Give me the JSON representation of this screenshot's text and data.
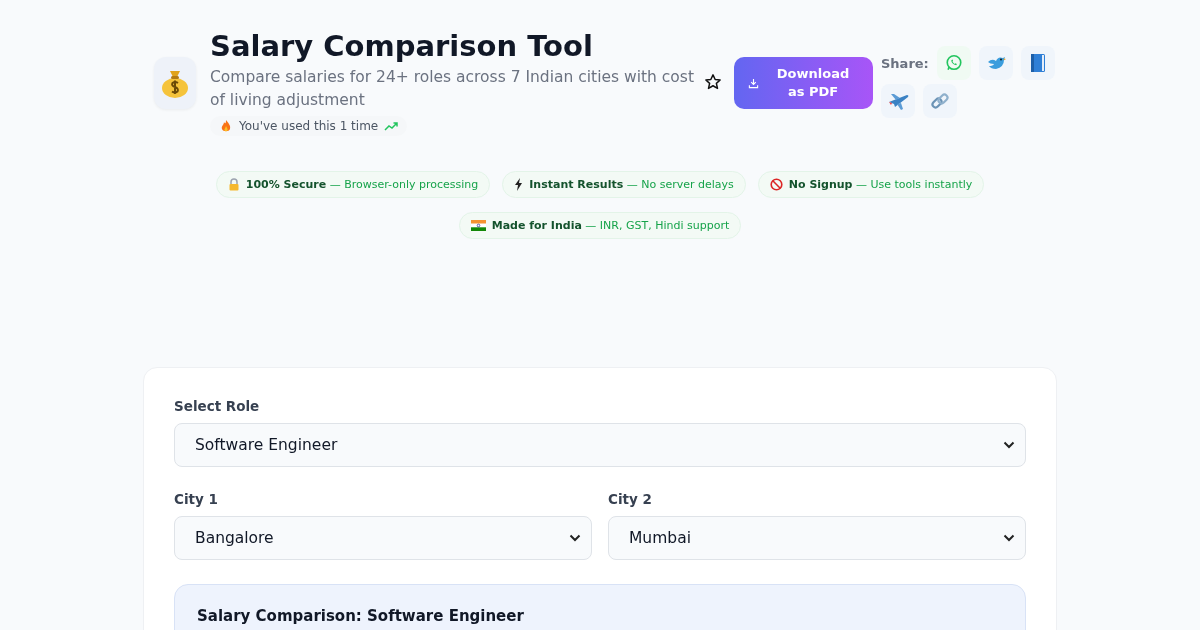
{
  "header": {
    "title": "Salary Comparison Tool",
    "subtitle": "Compare salaries for 24+ roles across 7 Indian cities with cost of living adjustment",
    "usage": "You've used this 1 time",
    "favorite": false,
    "download_button": "Download as PDF",
    "share_label": "Share:",
    "share_buttons": [
      {
        "kind": "whatsapp"
      },
      {
        "kind": "bird"
      },
      {
        "kind": "book"
      },
      {
        "kind": "plane"
      },
      {
        "kind": "link"
      }
    ]
  },
  "badges": [
    {
      "kind": "lock",
      "title": "100% Secure",
      "detail": "— Browser-only processing"
    },
    {
      "kind": "bolt",
      "title": "Instant Results",
      "detail": "— No server delays"
    },
    {
      "kind": "forbidden",
      "title": "No Signup",
      "detail": "— Use tools instantly"
    },
    {
      "kind": "flag",
      "title": "Made for India",
      "detail": "— INR, GST, Hindi support"
    }
  ],
  "form": {
    "role": {
      "label": "Select Role",
      "value": "Software Engineer"
    },
    "cities": [
      {
        "label": "City 1",
        "value": "Bangalore"
      },
      {
        "label": "City 2",
        "value": "Mumbai"
      }
    ],
    "result_title": "Salary Comparison: Software Engineer"
  }
}
